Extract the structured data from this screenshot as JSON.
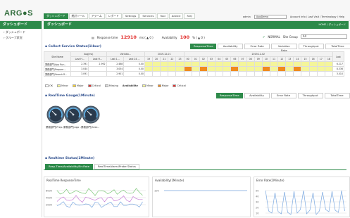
{
  "app": {
    "logo": "ARG●S",
    "user": "admin",
    "user_sel": "AppDemo",
    "user_links": "Account Info / Last Visit / Terminology / Help"
  },
  "menu": [
    "ダッシュボード",
    "統計ツール",
    "アラーム",
    "レポート",
    "Settings",
    "Services",
    "Tool",
    "Advice",
    "FAQ"
  ],
  "sidebar": {
    "title": "ダッシュボード",
    "items": [
      "ダッシュボード",
      "グループ状況"
    ]
  },
  "page": {
    "title": "ダッシュボード",
    "crumb": "HOME / ダッシュボード",
    "response_label": "Response time",
    "response_value": "12910",
    "response_unit": "ms ( ▲ 0 )",
    "availability_label": "Availability",
    "availability_value": "100",
    "availability_unit": "% ( ▲ 0 )",
    "normal_label": "NORMAL",
    "site_group_label": "Site Group",
    "site_group_value": "All"
  },
  "collect": {
    "title": "Collect Service Status(1Hour)",
    "tabs": [
      "ResponseTime",
      "Availability",
      "Error Rate",
      "Variation Rate",
      "Throughput",
      "TotalTime"
    ],
    "head": {
      "site": "Site Name",
      "avg": "Avg(ms)",
      "var": "Variatio...",
      "d1": "2019-12-01",
      "d2": "2019-12-02",
      "last": "Last",
      "subs": [
        "Last H...",
        "Last H...",
        "Last 1...",
        "Last 24 ..."
      ]
    },
    "hours": [
      "19",
      "20",
      "21",
      "22",
      "23",
      "00",
      "01",
      "02",
      "03",
      "04",
      "05",
      "06",
      "07",
      "08",
      "09",
      "10",
      "11",
      "12",
      "13",
      "14",
      "15",
      "16",
      "17",
      "18"
    ],
    "rows": [
      {
        "name": "業務部門(App Run...",
        "v": [
          "2.391",
          "2.992",
          "2.468",
          "0.00"
        ],
        "last": "6.217"
      },
      {
        "name": "業務部門(Prepare ...",
        "v": [
          "3.044",
          "",
          "3.054",
          "0.00"
        ],
        "last": "8.336"
      },
      {
        "name": "業務部門(Search R...",
        "v": [
          "3.091",
          "",
          "2.901",
          "0.00"
        ],
        "last": "3.010"
      }
    ],
    "legend": [
      "OK",
      "Minor",
      "Major",
      "Critical",
      "Missing",
      "Availability",
      "Minor",
      "Major",
      "Critical"
    ]
  },
  "gauge": {
    "title": "RealTime Gauge(1Minute)",
    "tabs": [
      "ResponseTime",
      "Availability",
      "Error Rate",
      "Throughput",
      "TotalTime"
    ],
    "items": [
      "業務部門(Prep...",
      "業務部門(App ...",
      "業務部門(Sear..."
    ]
  },
  "status": {
    "title": "Realtime Status(1Minute)",
    "tabs": [
      "Resp.Time/Availability/Err.Rate",
      "RealTimeAlarm/Probe Status"
    ]
  },
  "charts": [
    {
      "title": "RealTime ResponseTime",
      "ticks": [
        "6000",
        "4000",
        "2000"
      ]
    },
    {
      "title": "Availability(1Minute)",
      "ticks": [
        "100"
      ]
    },
    {
      "title": "Error Rate(1Minute)",
      "ticks": [
        "50",
        "40",
        "30",
        "20",
        "10"
      ]
    }
  ],
  "colors": {
    "green": "#2d8a4a",
    "ok": "#f4f59a",
    "minor": "#f5d232",
    "major": "#f08a1e",
    "critical": "#e2312f"
  }
}
